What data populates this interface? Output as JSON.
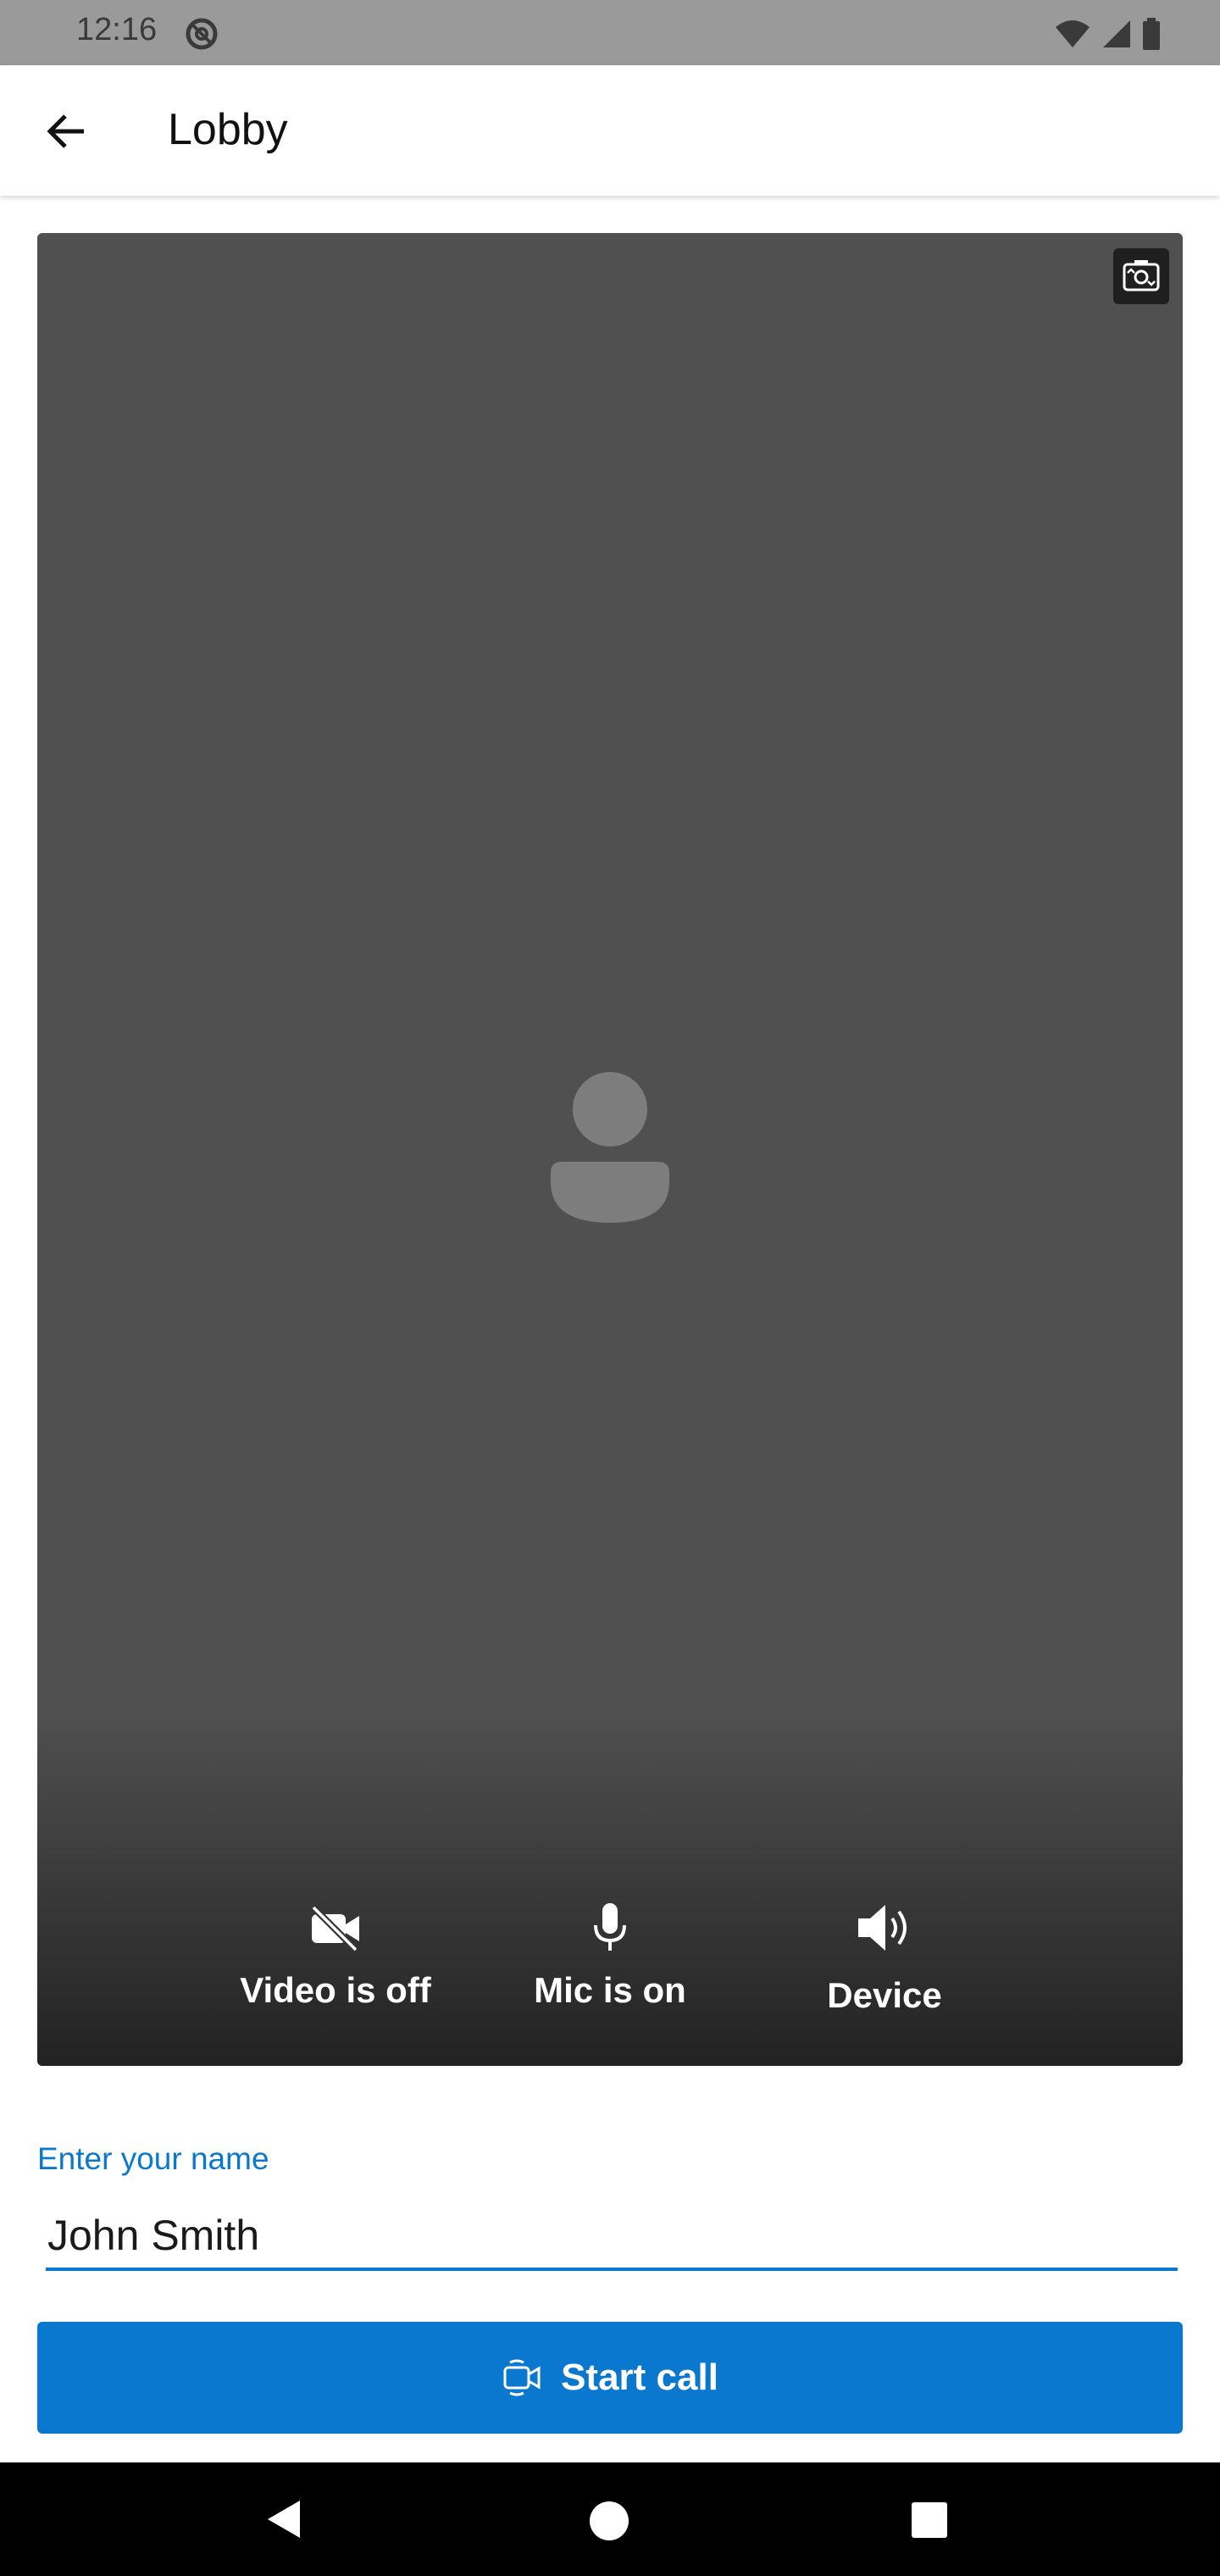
{
  "status_bar": {
    "time": "12:16"
  },
  "app_bar": {
    "title": "Lobby"
  },
  "preview": {
    "controls": {
      "video_label": "Video is off",
      "mic_label": "Mic is on",
      "device_label": "Device"
    }
  },
  "name_field": {
    "label": "Enter your name",
    "value": "John Smith"
  },
  "start_call": {
    "label": "Start call"
  },
  "colors": {
    "accent": "#0b78d0",
    "preview_bg": "#505050",
    "status_bar_bg": "#9a9a9a"
  },
  "icons": {
    "back": "arrow-left-icon",
    "switch_camera": "switch-camera-icon",
    "avatar": "person-placeholder-icon",
    "video": "video-off-icon",
    "mic": "microphone-icon",
    "device": "speaker-icon",
    "start_call": "video-call-icon"
  }
}
